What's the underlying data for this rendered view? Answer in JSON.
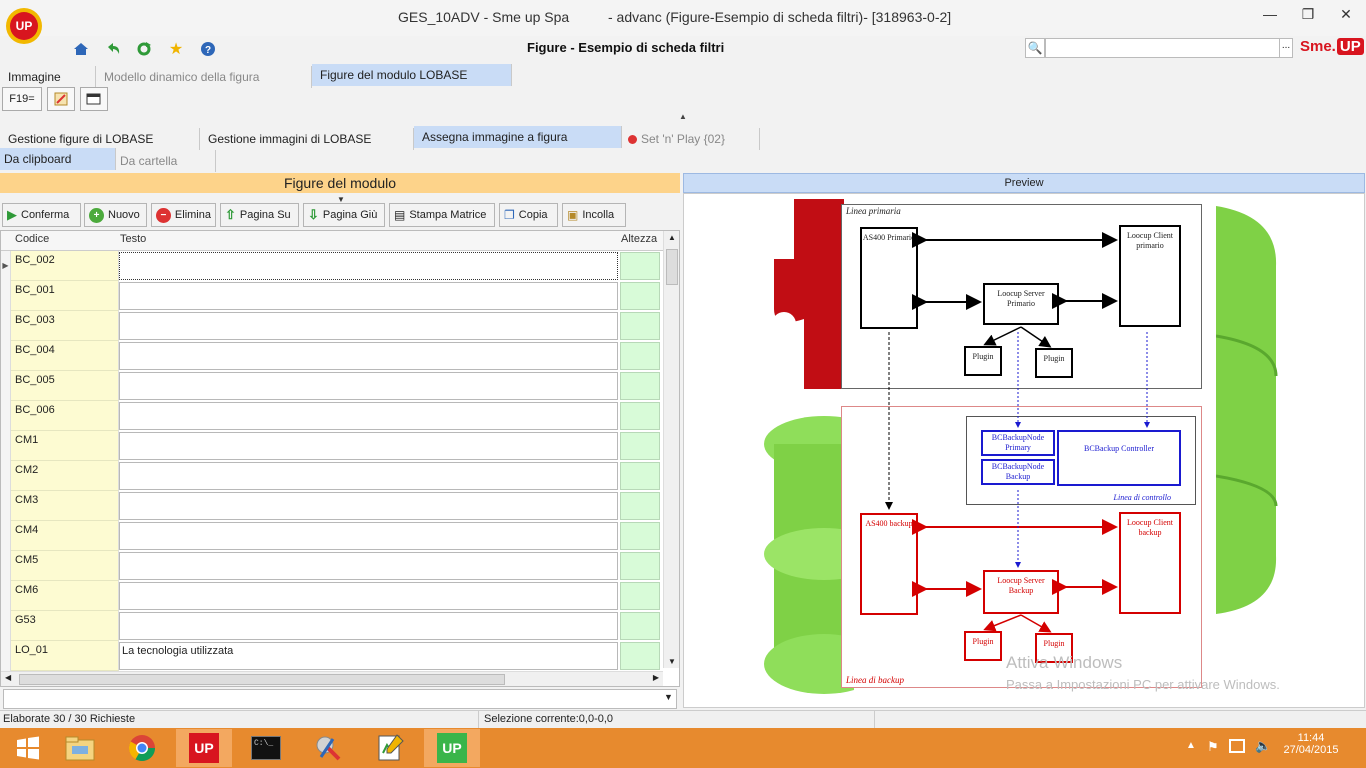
{
  "window": {
    "app_logo": "UP",
    "title_left": "GES_10ADV - Sme up Spa",
    "title_right": "- advanc (Figure-Esempio di scheda filtri)- [318963-0-2]",
    "minimize": "—",
    "restore": "❐",
    "close": "✕"
  },
  "toolbar": {
    "icons": [
      "home-icon",
      "back-icon",
      "refresh-icon",
      "favorite-icon",
      "help-icon"
    ],
    "page_title": "Figure - Esempio di scheda filtri",
    "search_placeholder": "",
    "search_more": "...",
    "brand_text": "Sme.",
    "brand_badge": "UP"
  },
  "tabs_top": [
    {
      "label": "Immagine",
      "active": false
    },
    {
      "label": "Modello dinamico della figura",
      "active": false,
      "dim": true
    },
    {
      "label": "Figure del modulo LOBASE",
      "active": true
    }
  ],
  "small_buttons": {
    "f19": "F19="
  },
  "tabs_mid": [
    {
      "label": "Gestione figure di LOBASE",
      "active": false
    },
    {
      "label": "Gestione immagini di LOBASE",
      "active": false
    },
    {
      "label": "Assegna immagine a figura",
      "active": true
    },
    {
      "label": "Set 'n' Play {02}",
      "active": false,
      "dim": true
    }
  ],
  "tabs_sub": [
    {
      "label": "Da clipboard",
      "active": true
    },
    {
      "label": "Da cartella",
      "active": false,
      "dim": true
    }
  ],
  "left_panel": {
    "header": "Figure del modulo",
    "actions": [
      {
        "label": "Conferma",
        "icon": "play-icon"
      },
      {
        "label": "Nuovo",
        "icon": "add-icon"
      },
      {
        "label": "Elimina",
        "icon": "delete-icon"
      },
      {
        "label": "Pagina Su",
        "icon": "arrow-up-icon"
      },
      {
        "label": "Pagina Giù",
        "icon": "arrow-down-icon"
      },
      {
        "label": "Stampa Matrice",
        "icon": "print-icon"
      },
      {
        "label": "Copia",
        "icon": "copy-icon"
      },
      {
        "label": "Incolla",
        "icon": "paste-icon"
      }
    ],
    "columns": [
      "Codice",
      "Testo",
      "Altezza"
    ],
    "rows": [
      {
        "code": "BC_002",
        "text": ""
      },
      {
        "code": "BC_001",
        "text": ""
      },
      {
        "code": "BC_003",
        "text": ""
      },
      {
        "code": "BC_004",
        "text": ""
      },
      {
        "code": "BC_005",
        "text": ""
      },
      {
        "code": "BC_006",
        "text": ""
      },
      {
        "code": "CM1",
        "text": ""
      },
      {
        "code": "CM2",
        "text": ""
      },
      {
        "code": "CM3",
        "text": ""
      },
      {
        "code": "CM4",
        "text": ""
      },
      {
        "code": "CM5",
        "text": ""
      },
      {
        "code": "CM6",
        "text": ""
      },
      {
        "code": "G53",
        "text": ""
      },
      {
        "code": "LO_01",
        "text": "La tecnologia utilizzata"
      }
    ]
  },
  "preview": {
    "header": "Preview",
    "diagram": {
      "primary_label": "Linea primaria",
      "backup_label": "Linea di backup",
      "control_label": "Linea di controllo",
      "as400_primary": "AS400 Primario",
      "client_primary": "Loocup Client primario",
      "server_primary": "Loocup Server Primario",
      "plugin1": "Plugin",
      "plugin2": "Plugin",
      "bc_node_primary": "BCBackupNode Primary",
      "bc_node_backup": "BCBackupNode Backup",
      "bc_controller": "BCBackup Controller",
      "as400_backup": "AS400 backup",
      "client_backup": "Loocup Client backup",
      "server_backup": "Loocup Server Backup",
      "plugin3": "Plugin",
      "plugin4": "Plugin"
    }
  },
  "watermark": {
    "line1": "Attiva Windows",
    "line2": "Passa a Impostazioni PC per attivare Windows."
  },
  "status": {
    "left": "Elaborate 30 / 30 Richieste",
    "right": "Selezione corrente:0,0-0,0"
  },
  "taskbar": {
    "apps": [
      "windows-start-icon",
      "file-explorer-icon",
      "chrome-icon",
      "smeup-icon",
      "cmd-icon",
      "tools-icon",
      "editor-icon",
      "smeup-active-icon"
    ],
    "up_label": "UP",
    "time": "11:44",
    "date": "27/04/2015"
  }
}
